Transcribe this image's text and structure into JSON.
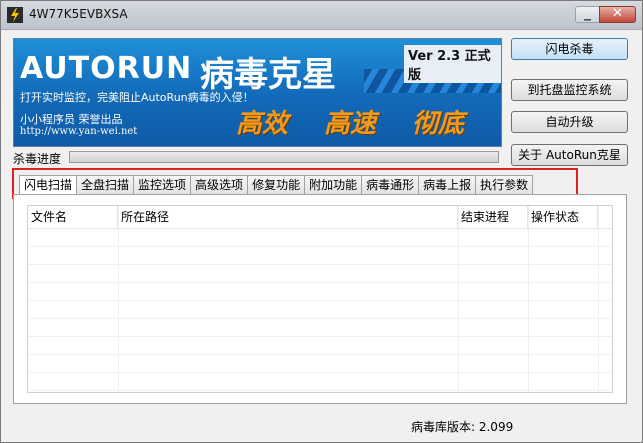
{
  "window": {
    "title": "4W77K5EVBXSA"
  },
  "banner": {
    "logo_text": "AUTORUN",
    "logo_cn": "病毒克星",
    "version": "Ver 2.3 正式版",
    "slogan": "打开实时监控，完美阻止AutoRun病毒的入侵！",
    "author": "小小程序员 荣誉出品",
    "url": "http://www.yan-wei.net",
    "tagline": [
      "高效",
      "高速",
      "彻底"
    ]
  },
  "buttons": {
    "quick_kill": "闪电杀毒",
    "tray_monitor": "到托盘监控系统",
    "auto_update": "自动升级",
    "about": "关于 AutoRun克星"
  },
  "progress": {
    "label": "杀毒进度",
    "value": 0
  },
  "tabs": [
    "闪电扫描",
    "全盘扫描",
    "监控选项",
    "高级选项",
    "修复功能",
    "附加功能",
    "病毒通形",
    "病毒上报",
    "执行参数"
  ],
  "table": {
    "columns": [
      "文件名",
      "所在路径",
      "结束进程",
      "操作状态"
    ]
  },
  "status": {
    "db_version": "病毒库版本: 2.099"
  },
  "colors": {
    "banner_blue": "#1269b8",
    "highlight_red": "#e02020",
    "tagline_orange": "#f29a1a"
  }
}
